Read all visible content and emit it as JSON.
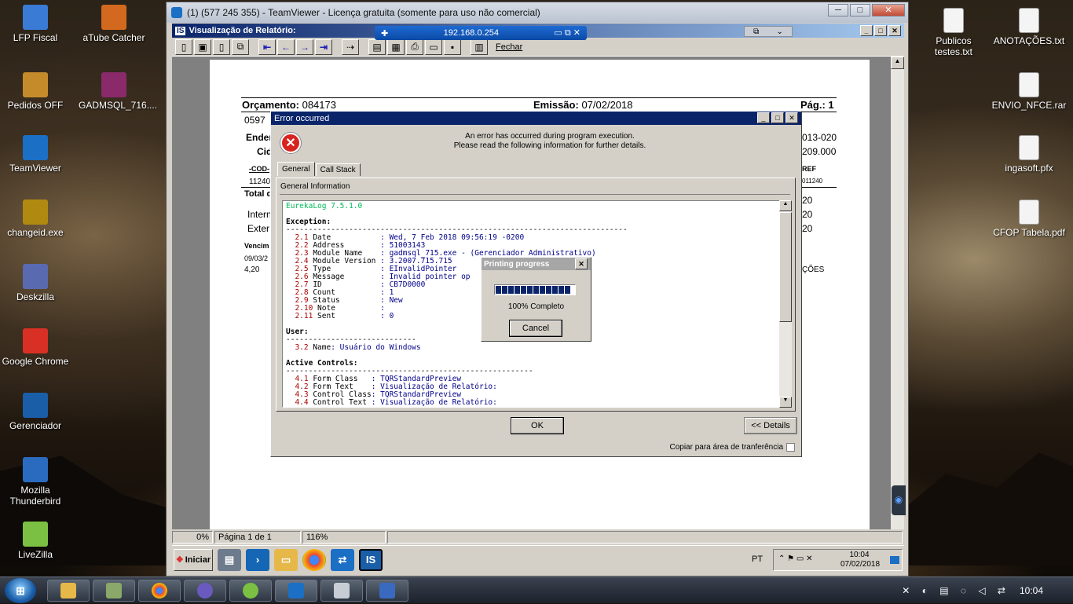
{
  "desktop_left": [
    {
      "label": "LFP Fiscal",
      "color": "#3a7bd5"
    },
    {
      "label": "aTube Catcher",
      "color": "#d2691e"
    },
    {
      "label": "Pedidos OFF",
      "color": "#c58b2b"
    },
    {
      "label": "GADMSQL_716....",
      "color": "#8a2a6a"
    },
    {
      "label": "TeamViewer",
      "color": "#1b6fc4"
    },
    {
      "label": "changeid.exe",
      "color": "#b08a10"
    },
    {
      "label": "Deskzilla",
      "color": "#5a6ab0"
    },
    {
      "label": "Google Chrome",
      "color": "#d93025"
    },
    {
      "label": "Gerenciador",
      "color": "#1a5ea8"
    },
    {
      "label": "Mozilla Thunderbird",
      "color": "#2b6bbf"
    },
    {
      "label": "LiveZilla",
      "color": "#7bc043"
    }
  ],
  "desktop_right": [
    {
      "label": "Publicos testes.txt"
    },
    {
      "label": "ANOTAÇÕES.txt"
    },
    {
      "label": "ENVIO_NFCE.rar"
    },
    {
      "label": "ingasoft.pfx"
    },
    {
      "label": "CFOP Tabela.pdf"
    }
  ],
  "teamviewer": {
    "title": "(1) (577 245 355) - TeamViewer - Licença gratuita (somente para uso não comercial)",
    "ip": "192.168.0.254"
  },
  "report": {
    "title": "Visualização de Relatório:",
    "fechar": "Fechar",
    "orcamento_label": "Orçamento:",
    "orcamento_value": "084173",
    "emissao_label": "Emissão:",
    "emissao_value": "07/02/2018",
    "pag_label": "Pág.: 1",
    "line1": "0597",
    "ender": "Ender",
    "cid": "Cid",
    "cod": "-COD-",
    "code": "11240",
    "total": "Total d",
    "inter": "Intern",
    "exter": "Exter",
    "venc": "Vencim",
    "venc_date": "09/03/2",
    "venc_val": "4,20",
    "r1": "013-020",
    "r2": "209.000",
    "r3": "REF",
    "r4": "011240",
    "r5": "20",
    "r6": "20",
    "r7": "20",
    "r8": "ÇÕES"
  },
  "statusbar": {
    "zoom_pct": "0%",
    "page": "Página 1 de 1",
    "zoom": "116%"
  },
  "xp_task": {
    "start": "Iniciar",
    "lang": "PT",
    "time": "10:04",
    "date": "07/02/2018"
  },
  "error": {
    "title": "Error occurred",
    "msg1": "An error has occurred during program execution.",
    "msg2": "Please read the following information for further details.",
    "tab_general": "General",
    "tab_callstack": "Call Stack",
    "general_info": "General Information",
    "log": [
      {
        "cls": "t",
        "text": "EurekaLog 7.5.1.0"
      },
      {
        "cls": "",
        "text": ""
      },
      {
        "cls": "h",
        "text": "Exception:"
      },
      {
        "cls": "",
        "text": "----------------------------------------------------------------------------"
      },
      {
        "cls": "r",
        "n": "  2.1",
        "k": " Date           ",
        "v": "Wed, 7 Feb 2018 09:56:19 -0200"
      },
      {
        "cls": "r",
        "n": "  2.2",
        "k": " Address        ",
        "v": "51003143"
      },
      {
        "cls": "r",
        "n": "  2.3",
        "k": " Module Name    ",
        "v": "gadmsql_715.exe - (Gerenciador Administrativo)"
      },
      {
        "cls": "r",
        "n": "  2.4",
        "k": " Module Version ",
        "v": "3.2007.715.715"
      },
      {
        "cls": "r",
        "n": "  2.5",
        "k": " Type           ",
        "v": "EInvalidPointer"
      },
      {
        "cls": "r",
        "n": "  2.6",
        "k": " Message        ",
        "v": "Invalid pointer op"
      },
      {
        "cls": "r",
        "n": "  2.7",
        "k": " ID             ",
        "v": "CB7D0000"
      },
      {
        "cls": "r",
        "n": "  2.8",
        "k": " Count          ",
        "v": "1"
      },
      {
        "cls": "r",
        "n": "  2.9",
        "k": " Status         ",
        "v": "New"
      },
      {
        "cls": "r",
        "n": "  2.10",
        "k": " Note          ",
        "v": ""
      },
      {
        "cls": "r",
        "n": "  2.11",
        "k": " Sent          ",
        "v": "0"
      },
      {
        "cls": "",
        "text": ""
      },
      {
        "cls": "h",
        "text": "User:"
      },
      {
        "cls": "",
        "text": "-----------------------------"
      },
      {
        "cls": "r",
        "n": "  3.2",
        "k": " Name",
        "v": "Usuário do Windows"
      },
      {
        "cls": "",
        "text": ""
      },
      {
        "cls": "h",
        "text": "Active Controls:"
      },
      {
        "cls": "",
        "text": "-------------------------------------------------------"
      },
      {
        "cls": "r",
        "n": "  4.1",
        "k": " Form Class   ",
        "v": "TQRStandardPreview"
      },
      {
        "cls": "r",
        "n": "  4.2",
        "k": " Form Text    ",
        "v": "Visualização de Relatório:"
      },
      {
        "cls": "r",
        "n": "  4.3",
        "k": " Control Class",
        "v": "TQRStandardPreview"
      },
      {
        "cls": "r",
        "n": "  4.4",
        "k": " Control Text ",
        "v": "Visualização de Relatório:"
      }
    ],
    "ok": "OK",
    "details": "<< Details",
    "copiar": "Copiar para área de tranferência"
  },
  "printing": {
    "title": "Printing progress",
    "percent_text": "100% Completo",
    "progress": 1.0,
    "cancel": "Cancel"
  },
  "win7": {
    "time": "10:04"
  }
}
